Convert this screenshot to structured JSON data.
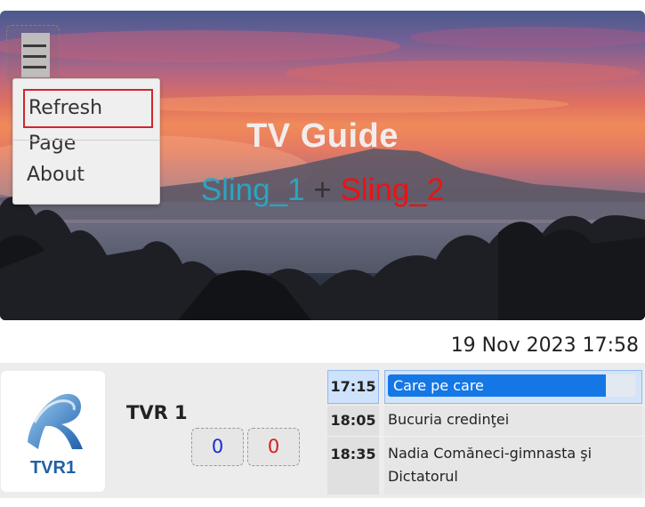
{
  "hero": {
    "title": "TV Guide",
    "subtitle_part1": "Sling_1",
    "subtitle_plus": "+",
    "subtitle_part2": "Sling_2",
    "colors": {
      "sling1": "#2aa5c0",
      "sling2": "#ee1111"
    }
  },
  "menu": {
    "toggle_icon": "hamburger-menu-icon",
    "items": [
      {
        "label": "Refresh Page",
        "highlighted": true
      },
      {
        "label": "About"
      }
    ]
  },
  "datetime": "19 Nov 2023 17:58",
  "channel": {
    "name": "TVR 1",
    "logo_text": "TVR1",
    "counter_blue": "0",
    "counter_red": "0",
    "programs": [
      {
        "time": "17:15",
        "title": "Care pe care",
        "current": true,
        "progress": 0.88
      },
      {
        "time": "18:05",
        "title": "Bucuria credinţei"
      },
      {
        "time": "18:35",
        "title": "Nadia Comăneci-gimnasta şi Dictatorul"
      }
    ]
  }
}
